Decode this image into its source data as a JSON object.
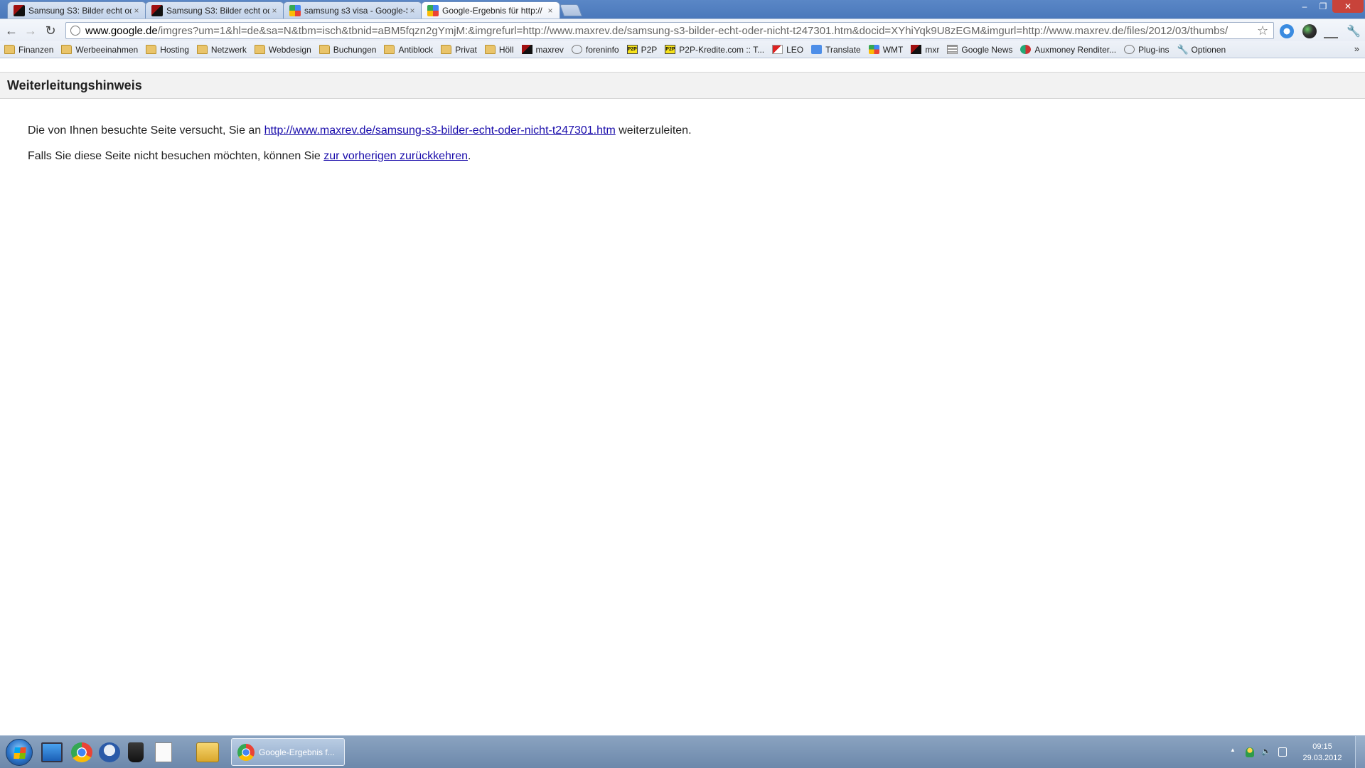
{
  "browser": {
    "tabs": [
      {
        "label": "Samsung S3: Bilder echt od",
        "close": "×",
        "favicon": "maxrev"
      },
      {
        "label": "Samsung S3: Bilder echt od",
        "close": "×",
        "favicon": "maxrev"
      },
      {
        "label": "samsung s3 visa - Google-S",
        "close": "×",
        "favicon": "google"
      },
      {
        "label": "Google-Ergebnis für http://",
        "close": "×",
        "favicon": "google",
        "active": true
      }
    ],
    "window_buttons": {
      "minimize": "–",
      "restore": "❐",
      "close": "✕"
    },
    "nav": {
      "back": "←",
      "forward": "→",
      "reload": "↻"
    },
    "address": {
      "host": "www.google.de",
      "path": "/imgres?um=1&hl=de&sa=N&tbm=isch&tbnid=aBM5fqzn2gYmjM:&imgrefurl=http://www.maxrev.de/samsung-s3-bilder-echt-oder-nicht-t247301.htm&docid=XYhiYqk9U8zEGM&imgurl=http://www.maxrev.de/files/2012/03/thumbs/"
    },
    "star": "☆",
    "wrench": "🔧",
    "bookmarks": [
      {
        "label": "Finanzen",
        "icon": "folder"
      },
      {
        "label": "Werbeeinahmen",
        "icon": "folder"
      },
      {
        "label": "Hosting",
        "icon": "folder"
      },
      {
        "label": "Netzwerk",
        "icon": "folder"
      },
      {
        "label": "Webdesign",
        "icon": "folder"
      },
      {
        "label": "Buchungen",
        "icon": "folder"
      },
      {
        "label": "Antiblock",
        "icon": "folder"
      },
      {
        "label": "Privat",
        "icon": "folder"
      },
      {
        "label": "Höll",
        "icon": "folder"
      },
      {
        "label": "maxrev",
        "icon": "mx"
      },
      {
        "label": "foreninfo",
        "icon": "globe"
      },
      {
        "label": "P2P",
        "icon": "p2p"
      },
      {
        "label": "P2P-Kredite.com :: T...",
        "icon": "p2p"
      },
      {
        "label": "LEO",
        "icon": "leo"
      },
      {
        "label": "Translate",
        "icon": "translate"
      },
      {
        "label": "WMT",
        "icon": "google"
      },
      {
        "label": "mxr",
        "icon": "mx"
      },
      {
        "label": "Google News",
        "icon": "news"
      },
      {
        "label": "Auxmoney Renditer...",
        "icon": "aux"
      },
      {
        "label": "Plug-ins",
        "icon": "globe"
      },
      {
        "label": "Optionen",
        "icon": "wrench"
      }
    ],
    "bookmarks_more": "»"
  },
  "page": {
    "heading": "Weiterleitungshinweis",
    "line1_prefix": "Die von Ihnen besuchte Seite versucht, Sie an ",
    "line1_link": "http://www.maxrev.de/samsung-s3-bilder-echt-oder-nicht-t247301.htm",
    "line1_suffix": " weiterzuleiten.",
    "line2_prefix": "Falls Sie diese Seite nicht besuchen möchten, können Sie ",
    "line2_link": "zur vorherigen zurückkehren",
    "line2_suffix": ".",
    "link_color": "#1a0dab"
  },
  "taskbar": {
    "active_window_label": "Google-Ergebnis f...",
    "tray": {
      "arrow": "▲",
      "volume": "🔈"
    },
    "clock": {
      "time": "09:15",
      "date": "29.03.2012"
    }
  }
}
